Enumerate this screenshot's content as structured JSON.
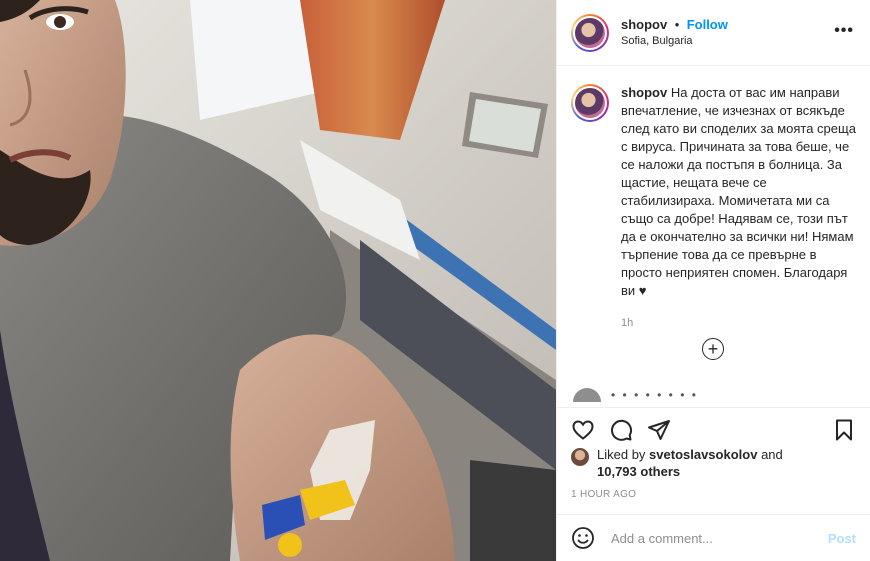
{
  "post": {
    "username": "shopov",
    "separator": "•",
    "follow_label": "Follow",
    "location": "Sofia, Bulgaria",
    "more_label": "•••"
  },
  "caption": {
    "username": "shopov",
    "text": "На доста от вас им направи впечатление, че изчезнах от всякъде след като ви споделих за моята среща с вируса. Причината за това беше, че се наложи да постъпя в болница. За щастие, нещата вече се стабилизираха. Момичетата ми са също са добре! Надявам се, този път да е окончателно за всички ни! Нямам търпение това да се превърне в просто неприятен спомен. Благодаря ви ♥",
    "time": "1h"
  },
  "load_more_label": "+",
  "cut_comment": "• •    •    •   •   •  •   •",
  "likes": {
    "prefix": "Liked by",
    "user": "svetoslavsokolov",
    "conjunction": "and",
    "others": "10,793 others"
  },
  "posted_ago": "1 HOUR AGO",
  "comment_box": {
    "placeholder": "Add a comment...",
    "post_label": "Post"
  },
  "icons": [
    "heart-icon",
    "comment-icon",
    "share-icon",
    "bookmark-icon",
    "emoji-icon",
    "more-icon",
    "add-circle-icon"
  ],
  "colors": {
    "link": "#0095f6",
    "muted": "#8e8e8e",
    "post_disabled": "#b2dffc",
    "text": "#262626"
  }
}
